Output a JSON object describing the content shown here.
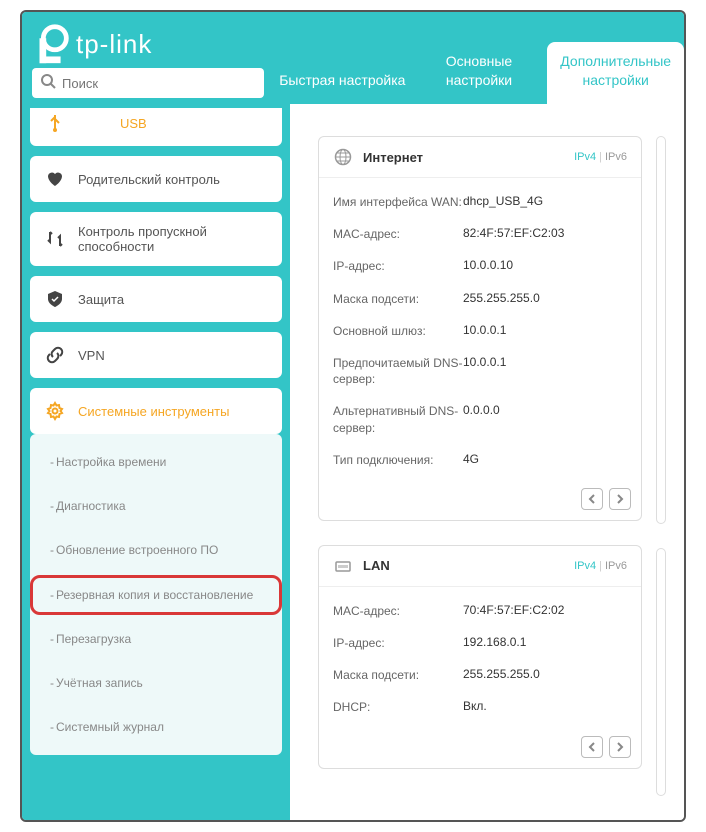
{
  "brand": "tp-link",
  "search": {
    "placeholder": "Поиск"
  },
  "tabs": [
    {
      "label": "Быстрая настройка"
    },
    {
      "label": "Основные настройки"
    },
    {
      "label": "Дополнительные настройки"
    }
  ],
  "nav": {
    "usb": "USB",
    "parental": "Родительский контроль",
    "bandwidth": "Контроль пропускной способности",
    "security": "Защита",
    "vpn": "VPN",
    "system": "Системные инструменты"
  },
  "subnav": {
    "time": "Настройка времени",
    "diag": "Диагностика",
    "firmware": "Обновление встроенного ПО",
    "backup": "Резервная копия и восстановление",
    "reboot": "Перезагрузка",
    "account": "Учётная запись",
    "syslog": "Системный журнал"
  },
  "internet": {
    "title": "Интернет",
    "ipv4": "IPv4",
    "ipv6": "IPv6",
    "rows": {
      "wan_iface_lbl": "Имя интерфейса WAN:",
      "wan_iface_val": "dhcp_USB_4G",
      "mac_lbl": "MAC-адрес:",
      "mac_val": "82:4F:57:EF:C2:03",
      "ip_lbl": "IP-адрес:",
      "ip_val": "10.0.0.10",
      "mask_lbl": "Маска подсети:",
      "mask_val": "255.255.255.0",
      "gw_lbl": "Основной шлюз:",
      "gw_val": "10.0.0.1",
      "dns1_lbl": "Предпочитаемый DNS-сервер:",
      "dns1_val": "10.0.0.1",
      "dns2_lbl": "Альтернативный DNS-сервер:",
      "dns2_val": "0.0.0.0",
      "type_lbl": "Тип подключения:",
      "type_val": "4G"
    }
  },
  "lan": {
    "title": "LAN",
    "ipv4": "IPv4",
    "ipv6": "IPv6",
    "rows": {
      "mac_lbl": "MAC-адрес:",
      "mac_val": "70:4F:57:EF:C2:02",
      "ip_lbl": "IP-адрес:",
      "ip_val": "192.168.0.1",
      "mask_lbl": "Маска подсети:",
      "mask_val": "255.255.255.0",
      "dhcp_lbl": "DHCP:",
      "dhcp_val": "Вкл."
    }
  }
}
